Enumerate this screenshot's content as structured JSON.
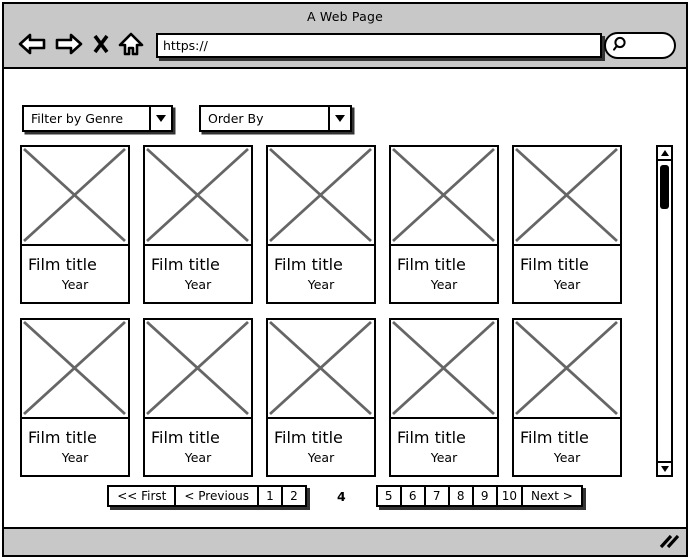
{
  "window": {
    "title": "A Web Page"
  },
  "toolbar": {
    "icons": [
      {
        "name": "back-arrow-icon",
        "label": "Back"
      },
      {
        "name": "forward-arrow-icon",
        "label": "Forward"
      },
      {
        "name": "stop-x-icon",
        "label": "Stop"
      },
      {
        "name": "home-icon",
        "label": "Home"
      }
    ],
    "url_value": "https://",
    "url_placeholder": "https://",
    "search_icon": "search-icon",
    "search_value": "",
    "search_placeholder": ""
  },
  "filters": {
    "genre": {
      "label": "Filter by Genre",
      "selected": "Filter by Genre",
      "arrow_icon": "chevron-down-icon"
    },
    "order": {
      "label": "Order By",
      "selected": "Order By",
      "arrow_icon": "chevron-down-icon"
    }
  },
  "grid": {
    "rows": [
      {
        "cards": [
          {
            "title": "Film title",
            "year": "Year",
            "thumb_icon": "image-placeholder-icon"
          },
          {
            "title": "Film title",
            "year": "Year",
            "thumb_icon": "image-placeholder-icon"
          },
          {
            "title": "Film title",
            "year": "Year",
            "thumb_icon": "image-placeholder-icon"
          },
          {
            "title": "Film title",
            "year": "Year",
            "thumb_icon": "image-placeholder-icon"
          },
          {
            "title": "Film title",
            "year": "Year",
            "thumb_icon": "image-placeholder-icon"
          }
        ]
      },
      {
        "cards": [
          {
            "title": "Film title",
            "year": "Year",
            "thumb_icon": "image-placeholder-icon"
          },
          {
            "title": "Film title",
            "year": "Year",
            "thumb_icon": "image-placeholder-icon"
          },
          {
            "title": "Film title",
            "year": "Year",
            "thumb_icon": "image-placeholder-icon"
          },
          {
            "title": "Film title",
            "year": "Year",
            "thumb_icon": "image-placeholder-icon"
          },
          {
            "title": "Film title",
            "year": "Year",
            "thumb_icon": "image-placeholder-icon"
          }
        ]
      }
    ]
  },
  "scrollbar": {
    "up_icon": "scroll-up-arrow-icon",
    "down_icon": "scroll-down-arrow-icon"
  },
  "pagination": {
    "left_group": [
      {
        "label": "<< First",
        "type": "nav"
      },
      {
        "label": "< Previous",
        "type": "nav"
      },
      {
        "label": "1",
        "type": "num"
      },
      {
        "label": "2",
        "type": "num"
      }
    ],
    "current_page": "4",
    "right_group": [
      {
        "label": "5",
        "type": "num"
      },
      {
        "label": "6",
        "type": "num"
      },
      {
        "label": "7",
        "type": "num"
      },
      {
        "label": "8",
        "type": "num"
      },
      {
        "label": "9",
        "type": "num"
      },
      {
        "label": "10",
        "type": "num"
      },
      {
        "label": "Next >",
        "type": "nav"
      }
    ]
  },
  "footer": {
    "resize_icon": "resize-grip-icon"
  },
  "colors": {
    "chrome": "#c8c8c8",
    "line": "#000000",
    "page": "#ffffff",
    "placeholder_cross": "#666666"
  }
}
